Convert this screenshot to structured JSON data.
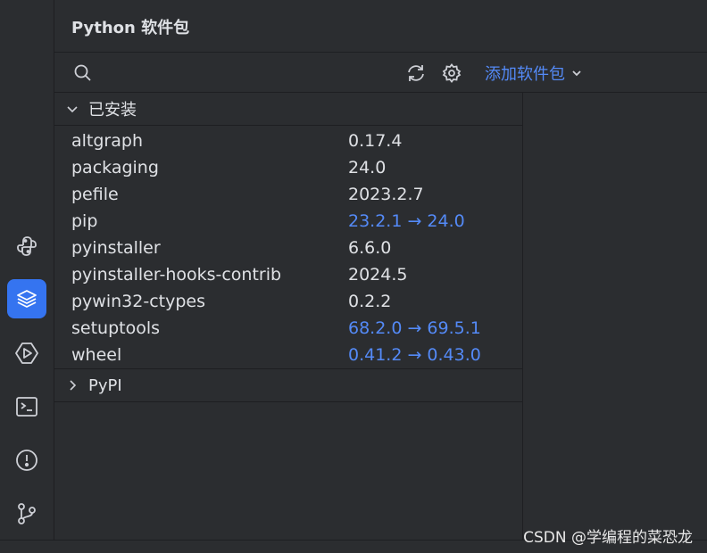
{
  "panel": {
    "title": "Python 软件包"
  },
  "toolbar": {
    "search_icon": "search-icon",
    "refresh_icon": "refresh-icon",
    "settings_icon": "gear-icon",
    "add_package_label": "添加软件包"
  },
  "installed": {
    "label": "已安装",
    "packages": [
      {
        "name": "altgraph",
        "version": "0.17.4"
      },
      {
        "name": "packaging",
        "version": "24.0"
      },
      {
        "name": "pefile",
        "version": "2023.2.7"
      },
      {
        "name": "pip",
        "version": "23.2.1 → 24.0"
      },
      {
        "name": "pyinstaller",
        "version": "6.6.0"
      },
      {
        "name": "pyinstaller-hooks-contrib",
        "version": "2024.5"
      },
      {
        "name": "pywin32-ctypes",
        "version": "0.2.2"
      },
      {
        "name": "setuptools",
        "version": "68.2.0 → 69.5.1"
      },
      {
        "name": "wheel",
        "version": "0.41.2 → 0.43.0"
      }
    ]
  },
  "pypi": {
    "label": "PyPI"
  },
  "toolstrip": [
    "python-icon",
    "packages-icon",
    "run-icon",
    "terminal-icon",
    "problems-icon",
    "git-icon"
  ],
  "colors": {
    "accent": "#3574f0",
    "link": "#548af7",
    "background": "#2b2d30"
  },
  "watermark": "CSDN @学编程的菜恐龙"
}
